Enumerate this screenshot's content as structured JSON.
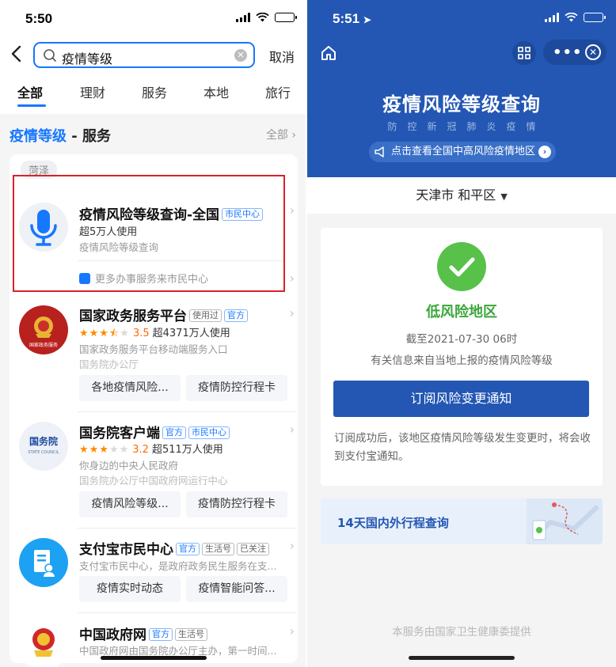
{
  "left": {
    "status": {
      "time": "5:50"
    },
    "search": {
      "value": "疫情等级",
      "cancel": "取消"
    },
    "tabs": [
      "全部",
      "理财",
      "服务",
      "本地",
      "旅行"
    ],
    "section": {
      "keyword": "疫情等级",
      "rest": " - 服务",
      "all": "全部"
    },
    "location_tag": "菏泽",
    "items": [
      {
        "title": "疫情风险等级查询-全国",
        "badges": [
          "市民中心"
        ],
        "usage": "超5万人使用",
        "desc": "疫情风险等级查询",
        "footer": "更多办事服务来市民中心"
      },
      {
        "title": "国家政务服务平台",
        "badges": [
          "使用过",
          "官方"
        ],
        "rating": "3.5",
        "usage": "超4371万人使用",
        "desc": "国家政务服务平台移动端服务入口",
        "org": "国务院办公厅",
        "logo_text": "国家政务服务",
        "actions": [
          "各地疫情风险...",
          "疫情防控行程卡"
        ]
      },
      {
        "title": "国务院客户端",
        "badges": [
          "官方",
          "市民中心"
        ],
        "rating": "3.2",
        "usage": "超511万人使用",
        "desc": "你身边的中央人民政府",
        "org": "国务院办公厅中国政府网运行中心",
        "logo_text": "国务院",
        "logo_sub": "STATE COUNCIL",
        "actions": [
          "疫情风险等级...",
          "疫情防控行程卡"
        ]
      },
      {
        "title": "支付宝市民中心",
        "badges": [
          "官方",
          "生活号",
          "已关注"
        ],
        "desc": "支付宝市民中心，是政府政务民生服务在支...",
        "actions": [
          "疫情实时动态",
          "疫情智能问答..."
        ]
      },
      {
        "title": "中国政府网",
        "badges": [
          "官方",
          "生活号"
        ],
        "desc": "中国政府网由国务院办公厅主办，第一时间..."
      }
    ]
  },
  "right": {
    "status": {
      "time": "5:51"
    },
    "title": "疫情风险等级查询",
    "subtitle": "防控新冠肺炎疫情",
    "notice": "点击查看全国中高风险疫情地区",
    "city": "天津市 和平区",
    "risk_level": "低风险地区",
    "as_of": "截至2021-07-30 06时",
    "note": "有关信息来自当地上报的疫情风险等级",
    "subscribe_label": "订阅风险变更通知",
    "subscribe_desc": "订阅成功后，该地区疫情风险等级发生变更时，将会收到支付宝通知。",
    "trip_label": "14天国内外行程查询",
    "provider": "本服务由国家卫生健康委提供"
  },
  "colors": {
    "alipay_blue": "#1677ff",
    "gov_blue": "#2357b3",
    "low_risk_green": "#57c14a",
    "highlight_red": "#d9222a",
    "star_orange": "#ff8a00"
  }
}
